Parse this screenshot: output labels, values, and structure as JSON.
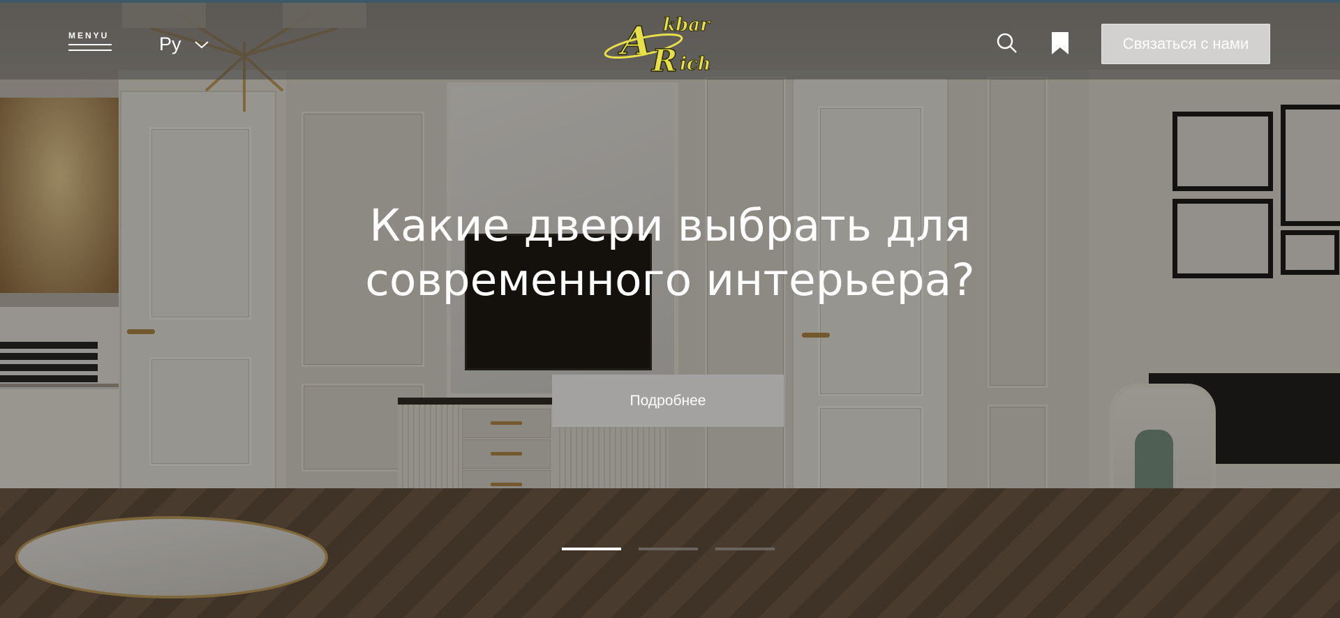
{
  "header": {
    "menu_label": "MENYU",
    "language": "Ру",
    "logo_text": "Akbar Rich",
    "contact_button": "Связаться с нами"
  },
  "hero": {
    "title_line1": "Какие двери выбрать для",
    "title_line2": "современного интерьера?",
    "button_label": "Подробнее",
    "slides": {
      "count": 3,
      "active": 1
    }
  },
  "icons": [
    "hamburger-menu-icon",
    "chevron-down-icon",
    "search-icon",
    "bookmark-icon"
  ],
  "colors": {
    "header_overlay": "#464442",
    "contact_button_bg": "#d2d1cf",
    "more_button_bg": "#a3a2a1",
    "logo_yellow": "#e8e04a",
    "top_line": "#3f5868"
  }
}
